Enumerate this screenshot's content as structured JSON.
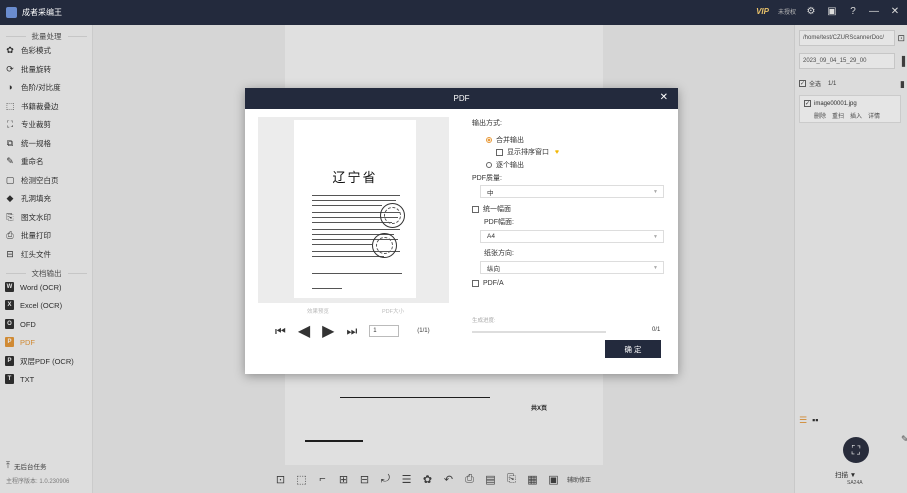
{
  "app": {
    "title": "成者采编王",
    "vip": "VIP",
    "status": "未授权"
  },
  "sidebar": {
    "section_batch": "批量处理",
    "items": [
      {
        "label": "色彩模式",
        "icon": "palette-icon"
      },
      {
        "label": "批量旋转",
        "icon": "rotate-icon"
      },
      {
        "label": "色阶/对比度",
        "icon": "contrast-icon"
      },
      {
        "label": "书籍裁叠边",
        "icon": "book-crop-icon"
      },
      {
        "label": "专业裁剪",
        "icon": "crop-icon"
      },
      {
        "label": "统一规格",
        "icon": "uniform-size-icon"
      },
      {
        "label": "重命名",
        "icon": "rename-icon"
      },
      {
        "label": "检测空白页",
        "icon": "blank-page-icon"
      },
      {
        "label": "孔洞填充",
        "icon": "fill-icon"
      },
      {
        "label": "图文水印",
        "icon": "watermark-icon"
      },
      {
        "label": "批量打印",
        "icon": "print-icon"
      },
      {
        "label": "红头文件",
        "icon": "red-header-icon"
      }
    ],
    "section_output": "文档输出",
    "outputs": [
      {
        "label": "Word (OCR)",
        "badge": "W"
      },
      {
        "label": "Excel (OCR)",
        "badge": "X"
      },
      {
        "label": "OFD",
        "badge": "O"
      },
      {
        "label": "PDF",
        "badge": "P"
      },
      {
        "label": "双层PDF (OCR)",
        "badge": "P"
      },
      {
        "label": "TXT",
        "badge": "T"
      }
    ],
    "background_tasks": "无后台任务",
    "version": "主程序版本: 1.0.230906"
  },
  "right_panel": {
    "path": "/home/test/CZURScannerDoc/",
    "folder": "2023_09_04_15_29_00",
    "select_all": "全选",
    "count": "1/1",
    "file_name": "image00001.jpg",
    "file_actions": [
      "删除",
      "重扫",
      "插入",
      "详情"
    ],
    "scan_label": "扫描 ▼",
    "device": "SA24A"
  },
  "background_doc": {
    "footer_text": "共X页"
  },
  "toolbar": {
    "ocr_correct": "辅助修正"
  },
  "dialog": {
    "title": "PDF",
    "preview": {
      "page_heading": "辽宁省",
      "label_effect": "效果预览",
      "label_size": "PDF大小",
      "page_input": "1",
      "page_total": "(1/1)"
    },
    "output_mode_label": "输出方式:",
    "merge_output": "合并输出",
    "show_order_window": "显示排序窗口",
    "individual_output": "逐个输出",
    "quality_label": "PDF质量:",
    "quality_value": "中",
    "unify_size": "统一幅面",
    "page_size_label": "PDF幅面:",
    "page_size_value": "A4",
    "orientation_label": "纸张方向:",
    "orientation_value": "纵向",
    "pdfa": "PDF/A",
    "progress_label": "生成进度:",
    "progress_count": "0/1",
    "progress": 0,
    "ok_button": "确 定"
  },
  "colors": {
    "titlebar": "#232a3d",
    "accent": "#e89a3a"
  }
}
